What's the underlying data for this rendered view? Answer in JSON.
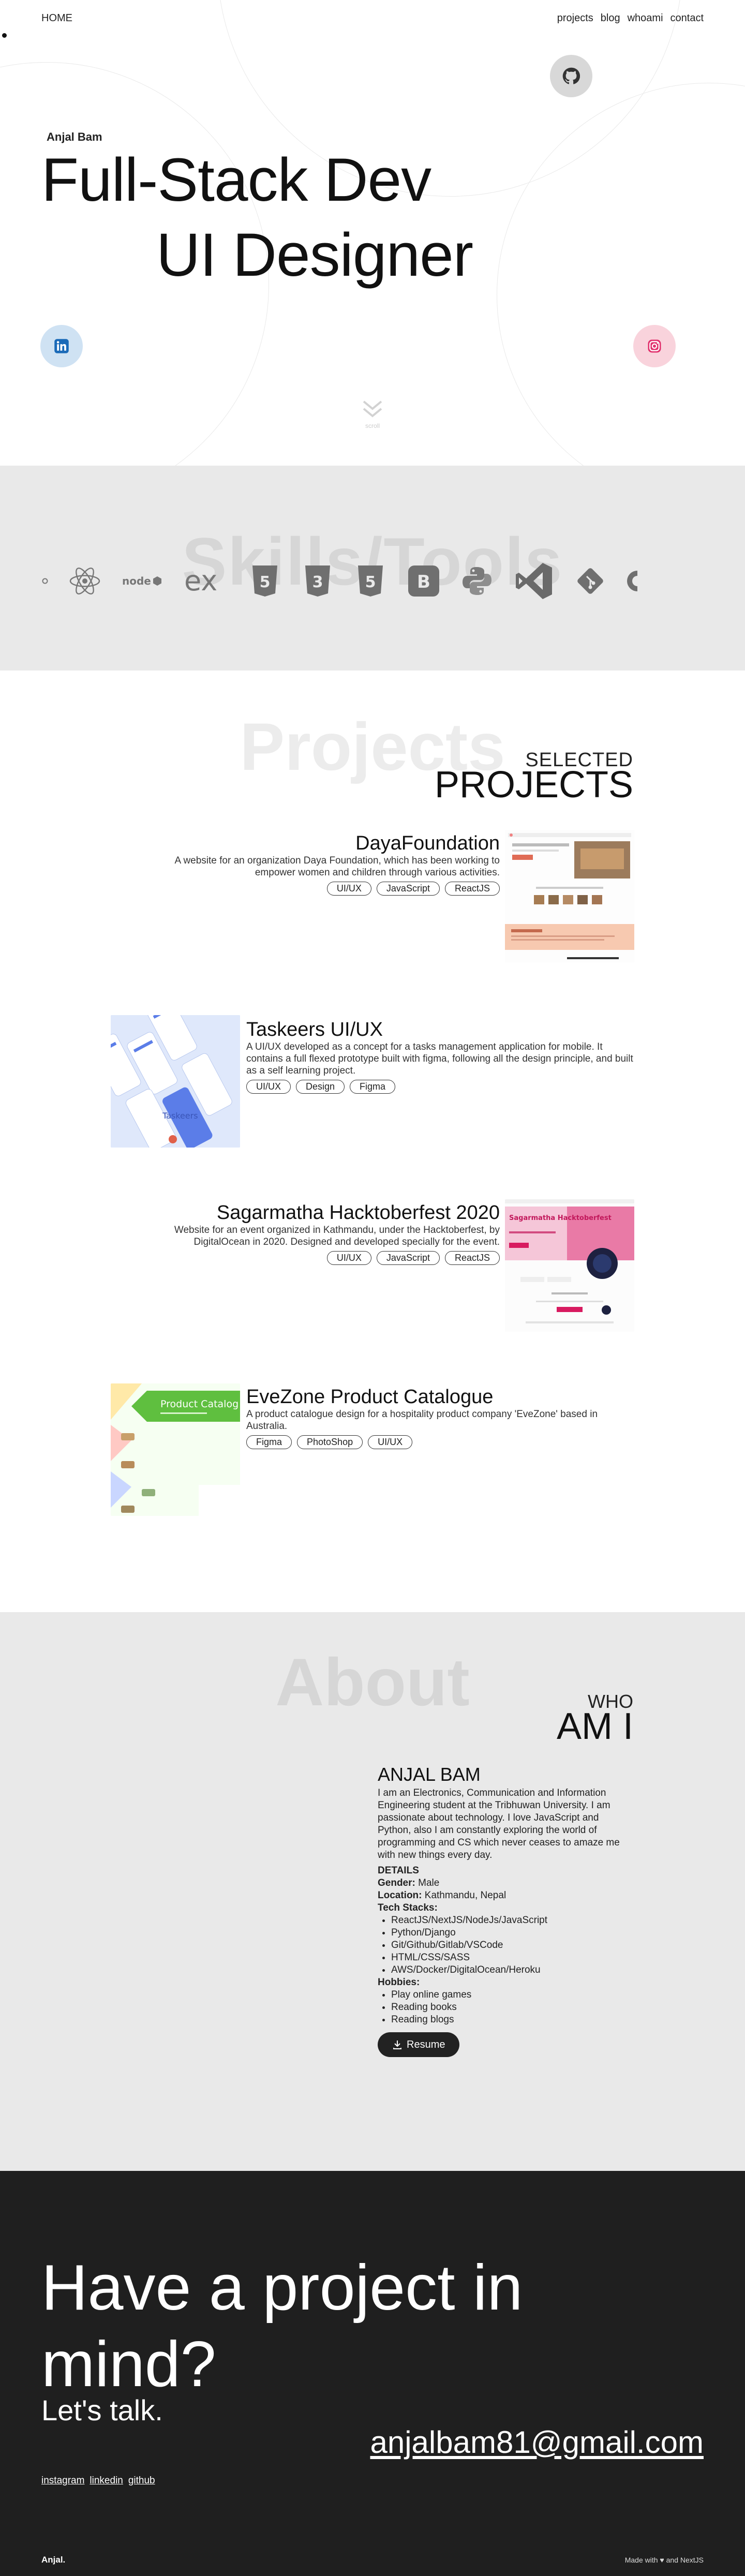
{
  "nav": {
    "home": "HOME",
    "links": [
      "projects",
      "blog",
      "whoami",
      "contact"
    ]
  },
  "hero": {
    "name": "Anjal Bam",
    "title_line1": "Full-Stack Dev",
    "title_line2": "UI Designer",
    "scroll_hint": "scroll"
  },
  "skills": {
    "heading": "Skills/Tools",
    "items": [
      "mongodb-icon",
      "react-icon",
      "nodejs-icon",
      "express-icon",
      "html5-icon",
      "css3-icon",
      "html5-icon",
      "bootstrap-icon",
      "python-icon",
      "vscode-icon",
      "git-icon",
      "github-icon"
    ]
  },
  "projects": {
    "watermark": "Projects",
    "label_small": "SELECTED",
    "label_big": "PROJECTS",
    "items": [
      {
        "title": "DayaFoundation",
        "desc": "A website for an organization Daya Foundation, which has been working to empower women and children through various activities.",
        "tags": [
          "UI/UX",
          "JavaScript",
          "ReactJS"
        ]
      },
      {
        "title": "Taskeers UI/UX",
        "desc": "A UI/UX developed as a concept for a tasks management application for mobile. It contains a full flexed prototype built with figma, following all the design principle, and built as a self learning project.",
        "tags": [
          "UI/UX",
          "Design",
          "Figma"
        ]
      },
      {
        "title": "Sagarmatha Hacktoberfest 2020",
        "desc": "Website for an event organized in Kathmandu, under the Hacktoberfest, by DigitalOcean in 2020. Designed and developed specially for the event.",
        "tags": [
          "UI/UX",
          "JavaScript",
          "ReactJS"
        ]
      },
      {
        "title": "EveZone Product Catalogue",
        "desc": "A product catalogue design for a hospitality product company 'EveZone' based in Australia.",
        "tags": [
          "Figma",
          "PhotoShop",
          "UI/UX"
        ]
      }
    ],
    "thumbs": {
      "evezone_label": "Product Catalog",
      "sagarmatha_label": "Sagarmatha Hacktoberfest",
      "taskeers_label": "Taskeers"
    }
  },
  "about": {
    "watermark": "About",
    "label_small": "WHO",
    "label_big": "AM I",
    "name": "ANJAL BAM",
    "bio": "I am an Electronics, Communication and Information Engineering student at the Tribhuwan University. I am passionate about technology. I love JavaScript and Python, also I am constantly exploring the world of programming and CS which never ceases to amaze me with new things every day.",
    "details_heading": "DETAILS",
    "gender_label": "Gender:",
    "gender": "Male",
    "location_label": "Location:",
    "location": "Kathmandu, Nepal",
    "tech_label": "Tech Stacks:",
    "tech": [
      "ReactJS/NextJS/NodeJs/JavaScript",
      "Python/Django",
      "Git/Github/Gitlab/VSCode",
      "HTML/CSS/SASS",
      "AWS/Docker/DigitalOcean/Heroku"
    ],
    "hobbies_label": "Hobbies:",
    "hobbies": [
      "Play online games",
      "Reading books",
      "Reading blogs"
    ],
    "resume": "Resume"
  },
  "contact": {
    "heading": "Have a project in mind?",
    "sub": "Let's talk.",
    "email": "anjalbam81@gmail.com",
    "links": [
      "instagram",
      "linkedin",
      "github"
    ],
    "brand": "Anjal.",
    "made_with": "Made with ♥ and NextJS"
  },
  "colors": {
    "section_gray": "#e9e9e9",
    "footer_dark": "#1f1f1f",
    "linkedin_bg": "#cfe2f3",
    "instagram_bg": "#f9d3dc",
    "github_bg": "#d8d8d8"
  }
}
